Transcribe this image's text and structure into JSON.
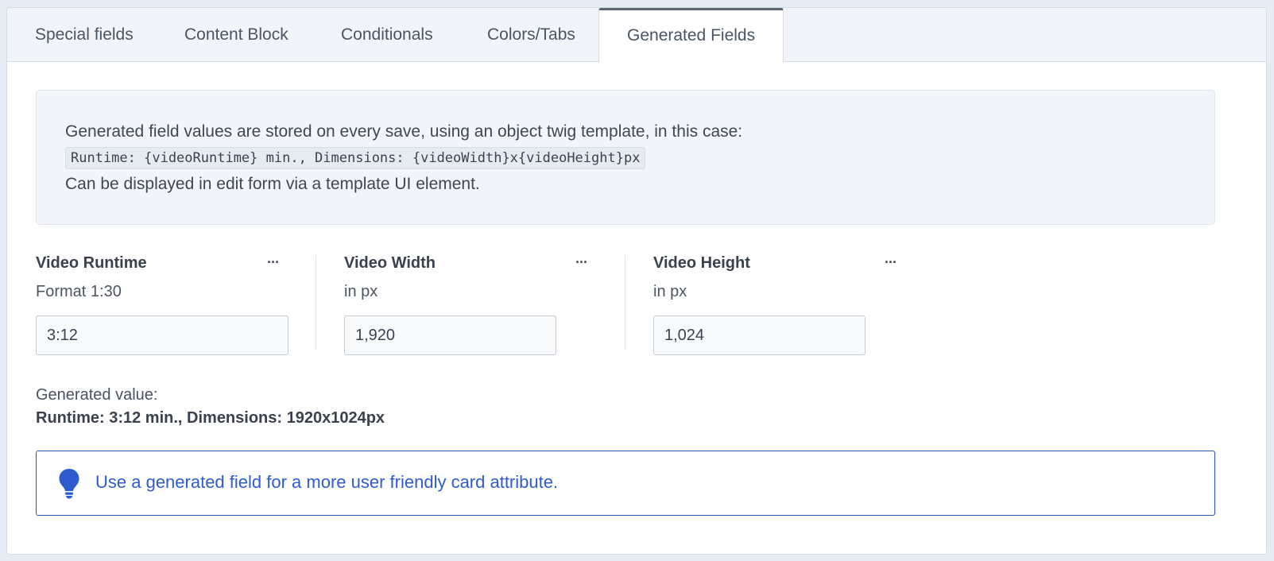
{
  "tabs": [
    {
      "label": "Special fields",
      "active": false
    },
    {
      "label": "Content Block",
      "active": false
    },
    {
      "label": "Conditionals",
      "active": false
    },
    {
      "label": "Colors/Tabs",
      "active": false
    },
    {
      "label": "Generated Fields",
      "active": true
    }
  ],
  "info": {
    "line1": "Generated field values are stored on every save, using an object twig template, in this case:",
    "code": "Runtime: {videoRuntime} min., Dimensions: {videoWidth}x{videoHeight}px",
    "line2": "Can be displayed in edit form via a template UI element."
  },
  "fields": [
    {
      "label": "Video Runtime",
      "help": "Format 1:30",
      "value": "3:12",
      "menu": "···"
    },
    {
      "label": "Video Width",
      "help": "in px",
      "value": "1,920",
      "menu": "···"
    },
    {
      "label": "Video Height",
      "help": "in px",
      "value": "1,024",
      "menu": "···"
    }
  ],
  "generated": {
    "label": "Generated value:",
    "value": "Runtime: 3:12 min., Dimensions: 1920x1024px"
  },
  "hint": {
    "icon": "lightbulb-icon",
    "text": "Use a generated field for a more user friendly card attribute."
  },
  "colors": {
    "accent": "#2e5bd0",
    "hint_border": "#2e55b8",
    "page_bg": "#e6ecf3"
  }
}
